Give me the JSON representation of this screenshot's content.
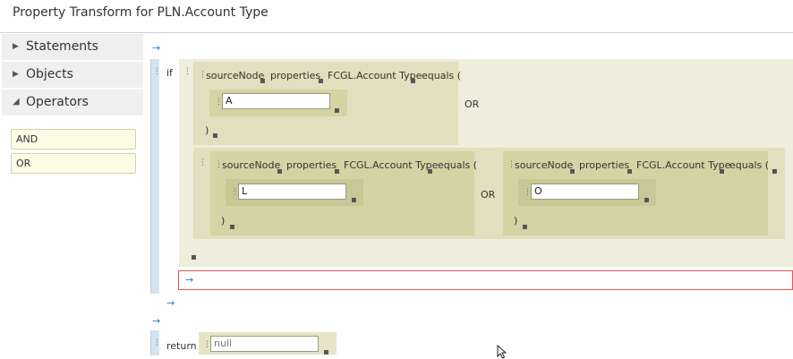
{
  "title": "Property Transform for PLN.Account Type",
  "sidebar": {
    "items": [
      {
        "label": "Statements",
        "expanded": false
      },
      {
        "label": "Objects",
        "expanded": false
      },
      {
        "label": "Operators",
        "expanded": true
      }
    ],
    "operators": [
      "AND",
      "OR"
    ]
  },
  "editor": {
    "if_keyword": "if",
    "or_keyword": "OR",
    "return_keyword": "return",
    "cond_top": {
      "source": "sourceNode",
      "properties": "properties",
      "property": "FCGL.Account Type",
      "op": "equals (",
      "value": "A",
      "close": ")"
    },
    "cond_left": {
      "source": "sourceNode",
      "properties": "properties",
      "property": "FCGL.Account Type",
      "op": "equals (",
      "value": "L",
      "close": ")"
    },
    "cond_right": {
      "source": "sourceNode",
      "properties": "properties",
      "property": "FCGL.Account Type",
      "op": "equals (",
      "value": "O",
      "close": ")"
    },
    "return_value": "null",
    "arrow_glyph": "→"
  },
  "colors": {
    "rail": "#d3e4ee",
    "block_outer": "#efeddc",
    "block_mid": "#e1dfbd",
    "block_inner": "#d4d3a4",
    "drop_target_border": "#e05858",
    "arrow": "#2a7fbf"
  }
}
